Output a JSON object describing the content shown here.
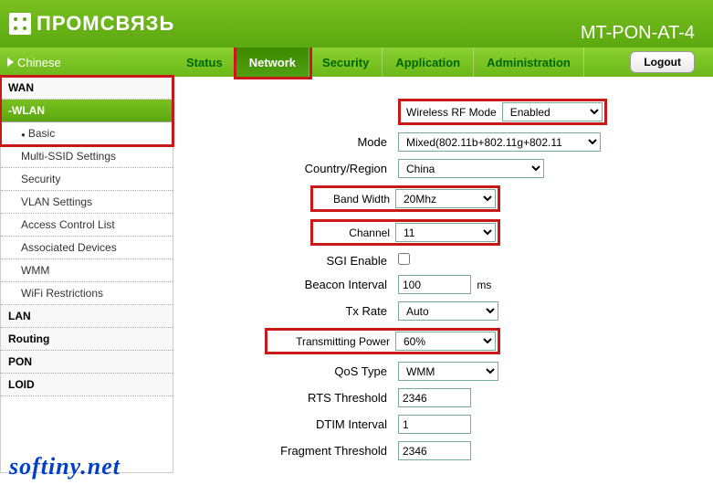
{
  "header": {
    "brand": "ПРОМСВЯЗЬ",
    "model": "MT-PON-AT-4"
  },
  "lang_link": "Chinese",
  "tabs": {
    "status": "Status",
    "network": "Network",
    "security": "Security",
    "application": "Application",
    "administration": "Administration"
  },
  "logout": "Logout",
  "sidebar": {
    "wan": "WAN",
    "wlan": "-WLAN",
    "basic": "Basic",
    "multi_ssid": "Multi-SSID Settings",
    "security": "Security",
    "vlan": "VLAN Settings",
    "acl": "Access Control List",
    "assoc": "Associated Devices",
    "wmm": "WMM",
    "wifi_restr": "WiFi Restrictions",
    "lan": "LAN",
    "routing": "Routing",
    "pon": "PON",
    "loid": "LOID"
  },
  "fields": {
    "rf_mode_lbl": "Wireless RF Mode",
    "rf_mode_val": "Enabled",
    "mode_lbl": "Mode",
    "mode_val": "Mixed(802.11b+802.11g+802.11",
    "country_lbl": "Country/Region",
    "country_val": "China",
    "bw_lbl": "Band Width",
    "bw_val": "20Mhz",
    "channel_lbl": "Channel",
    "channel_val": "11",
    "sgi_lbl": "SGI Enable",
    "beacon_lbl": "Beacon Interval",
    "beacon_val": "100",
    "beacon_unit": "ms",
    "txrate_lbl": "Tx Rate",
    "txrate_val": "Auto",
    "txpower_lbl": "Transmitting Power",
    "txpower_val": "60%",
    "qos_lbl": "QoS Type",
    "qos_val": "WMM",
    "rts_lbl": "RTS Threshold",
    "rts_val": "2346",
    "dtim_lbl": "DTIM Interval",
    "dtim_val": "1",
    "frag_lbl": "Fragment Threshold",
    "frag_val": "2346"
  },
  "watermark": "softiny.net"
}
